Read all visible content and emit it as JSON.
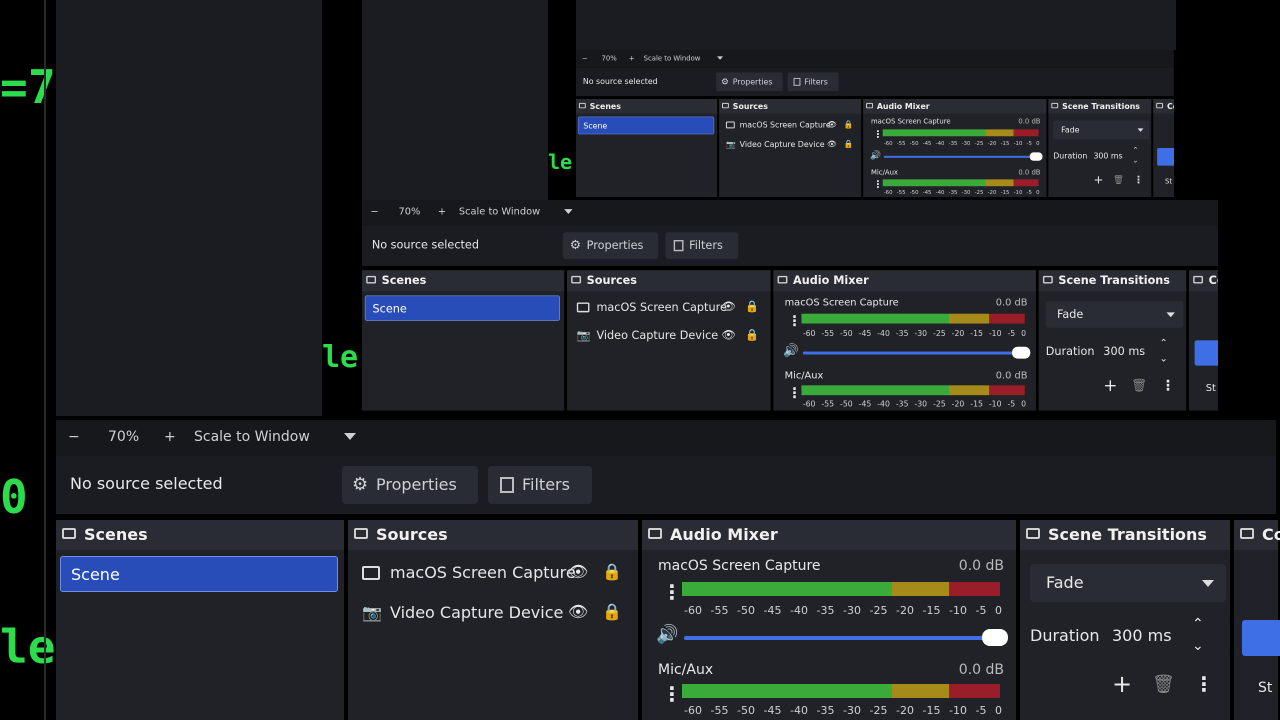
{
  "toolbar": {
    "minus": "−",
    "zoom": "70%",
    "plus": "+",
    "scale_mode": "Scale to Window"
  },
  "source_bar": {
    "status": "No source selected",
    "properties_label": "Properties",
    "filters_label": "Filters"
  },
  "scenes": {
    "title": "Scenes",
    "items": [
      "Scene"
    ]
  },
  "sources": {
    "title": "Sources",
    "items": [
      {
        "label": "macOS Screen Capture",
        "icon": "monitor-icon"
      },
      {
        "label": "Video Capture Device",
        "icon": "camera-icon"
      }
    ]
  },
  "mixer": {
    "title": "Audio Mixer",
    "channels": [
      {
        "name": "macOS Screen Capture",
        "level": "0.0 dB"
      },
      {
        "name": "Mic/Aux",
        "level": "0.0 dB"
      }
    ],
    "scale": [
      "-60",
      "-55",
      "-50",
      "-45",
      "-40",
      "-35",
      "-30",
      "-25",
      "-20",
      "-15",
      "-10",
      "-5",
      "0"
    ],
    "volume_fraction": 1.0
  },
  "transitions": {
    "title": "Scene Transitions",
    "selected": "Fade",
    "duration_label": "Duration",
    "duration_value": "300 ms"
  },
  "controls": {
    "title_clip": "Co",
    "start_clip": "St"
  },
  "background": {
    "matrix_chars": [
      "=",
      "7",
      "(",
      "(",
      "0",
      "le"
    ]
  },
  "colors": {
    "accent": "#284cb8",
    "meter_green": "#3aaa3a",
    "meter_yellow": "#a68a1a",
    "meter_red": "#9a1e2a",
    "matrix_green": "#2bdc4d"
  }
}
